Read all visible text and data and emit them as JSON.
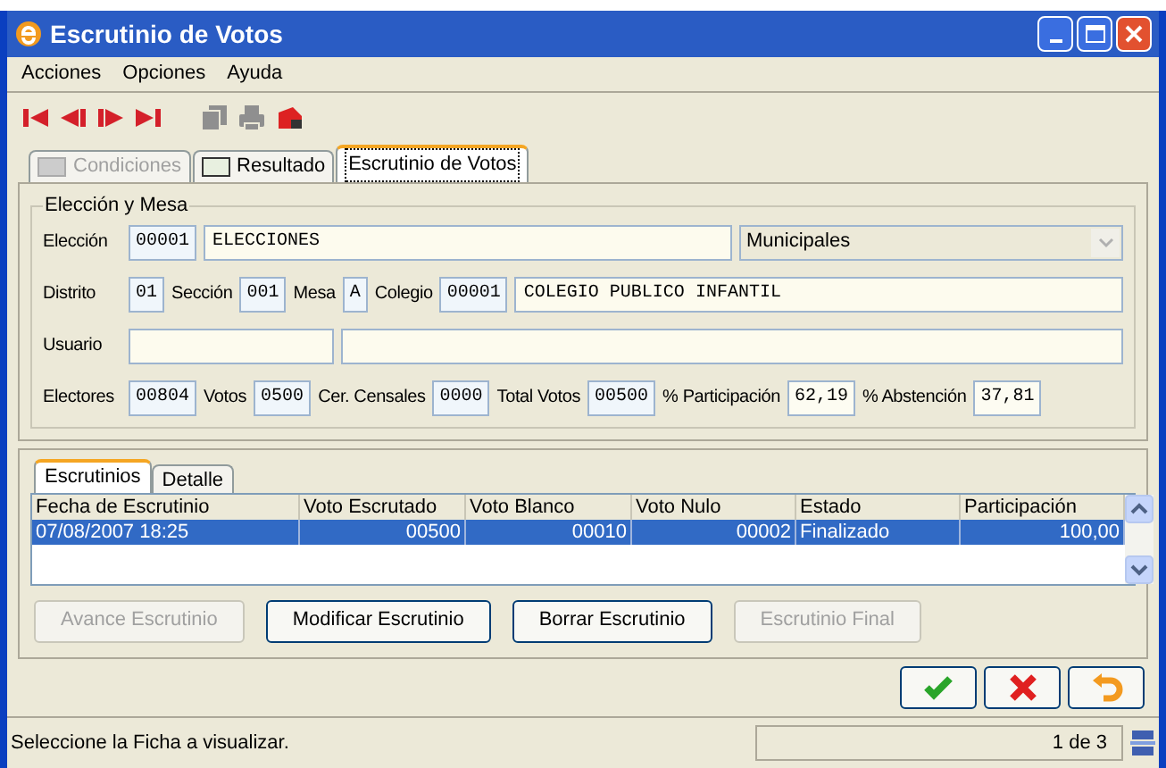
{
  "window": {
    "title": "Escrutinio de Votos"
  },
  "menu": [
    "Acciones",
    "Opciones",
    "Ayuda"
  ],
  "toolbar": [
    {
      "kind": "first",
      "disabled": false
    },
    {
      "kind": "prev",
      "disabled": false
    },
    {
      "kind": "next",
      "disabled": false
    },
    {
      "kind": "last",
      "disabled": false
    },
    {
      "kind": "copy",
      "disabled": true
    },
    {
      "kind": "print",
      "disabled": true
    },
    {
      "kind": "exit",
      "disabled": false
    }
  ],
  "tabs": [
    {
      "label": "Condiciones",
      "selected": false,
      "disabled": true
    },
    {
      "label": "Resultado",
      "selected": false,
      "disabled": false
    },
    {
      "label": "Escrutinio de Votos",
      "selected": true,
      "disabled": false
    }
  ],
  "group": {
    "title": "Elección y Mesa",
    "rows": [
      {
        "items": [
          {
            "kind": "label",
            "text": "Elección"
          },
          {
            "kind": "code",
            "value": "00001"
          },
          {
            "kind": "text",
            "value": "ELECCIONES"
          },
          {
            "kind": "select",
            "value": "Municipales",
            "disabled": true
          }
        ]
      },
      {
        "items": [
          {
            "kind": "label",
            "text": "Distrito"
          },
          {
            "kind": "code",
            "value": "01"
          },
          {
            "kind": "label",
            "text": "Sección"
          },
          {
            "kind": "code",
            "value": "001"
          },
          {
            "kind": "label",
            "text": "Mesa"
          },
          {
            "kind": "code",
            "value": "A"
          },
          {
            "kind": "label",
            "text": "Colegio"
          },
          {
            "kind": "code",
            "value": "00001"
          },
          {
            "kind": "text",
            "value": "COLEGIO PUBLICO INFANTIL"
          }
        ]
      },
      {
        "items": [
          {
            "kind": "label",
            "text": "Usuario"
          },
          {
            "kind": "blank"
          },
          {
            "kind": "text"
          }
        ]
      },
      {
        "items": [
          {
            "kind": "label",
            "text": "Electores"
          },
          {
            "kind": "code",
            "value": "00804"
          },
          {
            "kind": "label",
            "text": "Votos"
          },
          {
            "kind": "code",
            "value": "0500"
          },
          {
            "kind": "label",
            "text": "Cer. Censales"
          },
          {
            "kind": "code",
            "value": "0000"
          },
          {
            "kind": "label",
            "text": "Total Votos"
          },
          {
            "kind": "code",
            "value": "00500"
          },
          {
            "kind": "label",
            "text": "% Participación"
          },
          {
            "kind": "number",
            "value": "62,19"
          },
          {
            "kind": "label",
            "text": "% Abstención"
          },
          {
            "kind": "number",
            "value": "37,81"
          }
        ]
      }
    ]
  },
  "subtabs": [
    {
      "label": "Escrutinios",
      "selected": true
    },
    {
      "label": "Detalle",
      "selected": false
    }
  ],
  "table": {
    "columns": [
      "Fecha de Escrutinio",
      "Voto Escrutado",
      "Voto Blanco",
      "Voto Nulo",
      "Estado",
      "Participación"
    ],
    "rows": [
      {
        "selected": true,
        "cells": [
          "07/08/2007 18:25",
          "00500",
          "00010",
          "00002",
          "Finalizado",
          "100,00"
        ]
      }
    ]
  },
  "actions": [
    {
      "label": "Avance Escrutinio",
      "disabled": true
    },
    {
      "label": "Modificar Escrutinio",
      "disabled": false
    },
    {
      "label": "Borrar Escrutinio",
      "disabled": false
    },
    {
      "label": "Escrutinio Final",
      "disabled": true
    }
  ],
  "dialog_buttons": [
    {
      "kind": "accept"
    },
    {
      "kind": "cancel"
    },
    {
      "kind": "undo"
    }
  ],
  "status_bar": {
    "message": "Seleccione la Ficha a visualizar.",
    "record": "1 de 3"
  }
}
